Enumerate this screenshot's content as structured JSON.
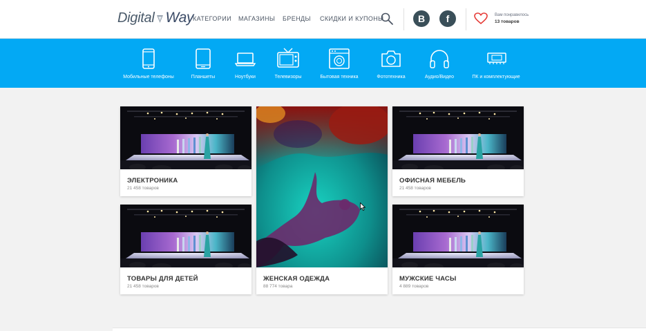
{
  "header": {
    "logo": {
      "part1": "Digital",
      "part2": "Way"
    },
    "nav": [
      {
        "label": "КАТЕГОРИИ"
      },
      {
        "label": "МАГАЗИНЫ"
      },
      {
        "label": "БРЕНДЫ"
      },
      {
        "label": "СКИДКИ И КУПОНЫ"
      }
    ],
    "social": {
      "vk": "B",
      "fb": "f"
    },
    "likes": {
      "label": "Вам понравилось",
      "count": "13 товаров"
    }
  },
  "categories": [
    {
      "label": "Мобильные телефоны",
      "icon": "phone-icon"
    },
    {
      "label": "Планшеты",
      "icon": "tablet-icon"
    },
    {
      "label": "Ноутбуки",
      "icon": "laptop-icon"
    },
    {
      "label": "Телевизоры",
      "icon": "tv-icon"
    },
    {
      "label": "Бытовая техника",
      "icon": "washing-machine-icon"
    },
    {
      "label": "Фототехника",
      "icon": "camera-icon"
    },
    {
      "label": "Аудио/Видео",
      "icon": "headphones-icon"
    },
    {
      "label": "ПК и комплектующие",
      "icon": "pc-components-icon"
    }
  ],
  "cards": [
    {
      "title": "ЭЛЕКТРОНИКА",
      "count": "21 458 товаров"
    },
    {
      "title": "ЖЕНСКАЯ ОДЕЖДА",
      "count": "88 774 товара"
    },
    {
      "title": "ОФИСНАЯ МЕБЕЛЬ",
      "count": "21 458 товаров"
    },
    {
      "title": "ТОВАРЫ ДЛЯ ДЕТЕЙ",
      "count": "21 458 товаров"
    },
    {
      "title": "МУЖСКИЕ ЧАСЫ",
      "count": "4 889 товаров"
    }
  ],
  "colors": {
    "accent": "#03a9f4",
    "social": "#3a4f59",
    "heart": "#e53935"
  }
}
